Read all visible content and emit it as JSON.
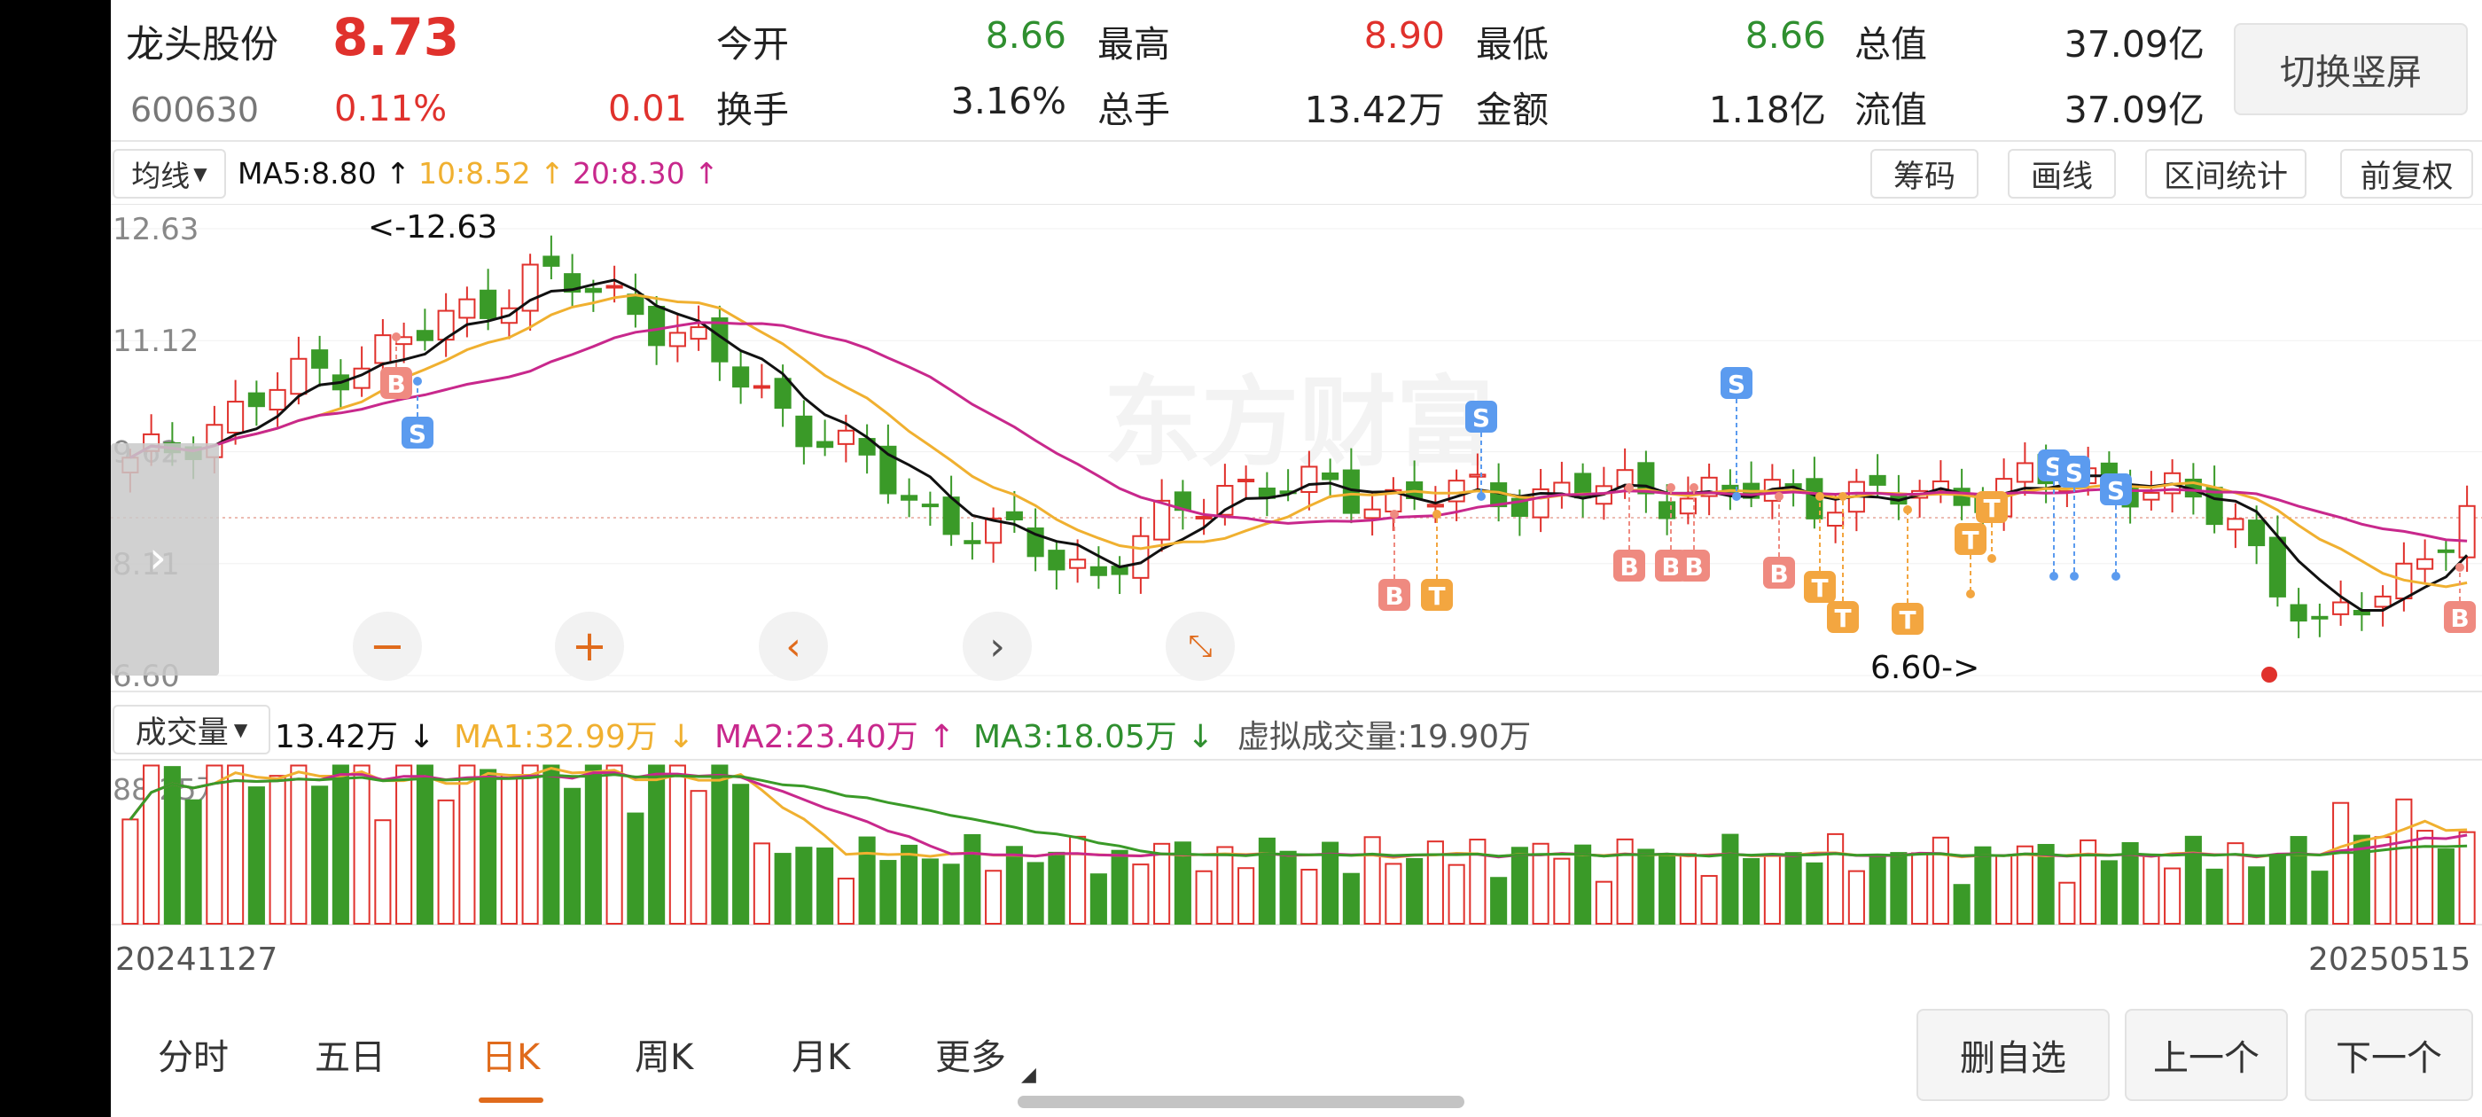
{
  "header": {
    "stock_name": "龙头股份",
    "price": "8.73",
    "code": "600630",
    "change_pct": "0.11%",
    "change_amt": "0.01",
    "rows": [
      [
        {
          "label": "今开",
          "value": "8.66",
          "color": "green"
        },
        {
          "label": "最高",
          "value": "8.90",
          "color": "red"
        },
        {
          "label": "最低",
          "value": "8.66",
          "color": "green"
        },
        {
          "label": "总值",
          "value": "37.09亿",
          "color": "dark"
        }
      ],
      [
        {
          "label": "换手",
          "value": "3.16%",
          "color": "dark"
        },
        {
          "label": "总手",
          "value": "13.42万",
          "color": "dark"
        },
        {
          "label": "金额",
          "value": "1.18亿",
          "color": "dark"
        },
        {
          "label": "流值",
          "value": "37.09亿",
          "color": "dark"
        }
      ]
    ],
    "toggle_label": "切换竖屏"
  },
  "ma_bar": {
    "selector": "均线",
    "ma5": "MA5:8.80",
    "ma10": "10:8.52",
    "ma20": "20:8.30",
    "tools": [
      "筹码",
      "画线",
      "区间统计",
      "前复权"
    ]
  },
  "kline": {
    "y_labels": [
      "12.63",
      "11.12",
      "9.62",
      "8.11",
      "6.60"
    ],
    "high_annotation": "<-12.63",
    "low_annotation": "6.60->",
    "watermark": "东方财富"
  },
  "volume_bar": {
    "selector": "成交量",
    "current": "13.42万",
    "ma1": "MA1:32.99万",
    "ma2": "MA2:23.40万",
    "ma3": "MA3:18.05万",
    "virtual": "虚拟成交量:19.90万",
    "y_label": "88.25万"
  },
  "dates": {
    "start": "20241127",
    "end": "20250515"
  },
  "tabs": [
    "分时",
    "五日",
    "日K",
    "周K",
    "月K",
    "更多"
  ],
  "active_tab": "日K",
  "bottom_buttons": [
    "删自选",
    "上一个",
    "下一个"
  ],
  "signals": {
    "buy": "B",
    "sell": "S",
    "t": "T"
  },
  "colors": {
    "up": "#e0312c",
    "down": "#3a9a28",
    "ma5": "#111111",
    "ma10": "#f0b030",
    "ma20": "#c8288c",
    "accent": "#e06b1c",
    "buy": "#ef8a80",
    "sell": "#5b9bef",
    "t": "#f3a640"
  }
}
